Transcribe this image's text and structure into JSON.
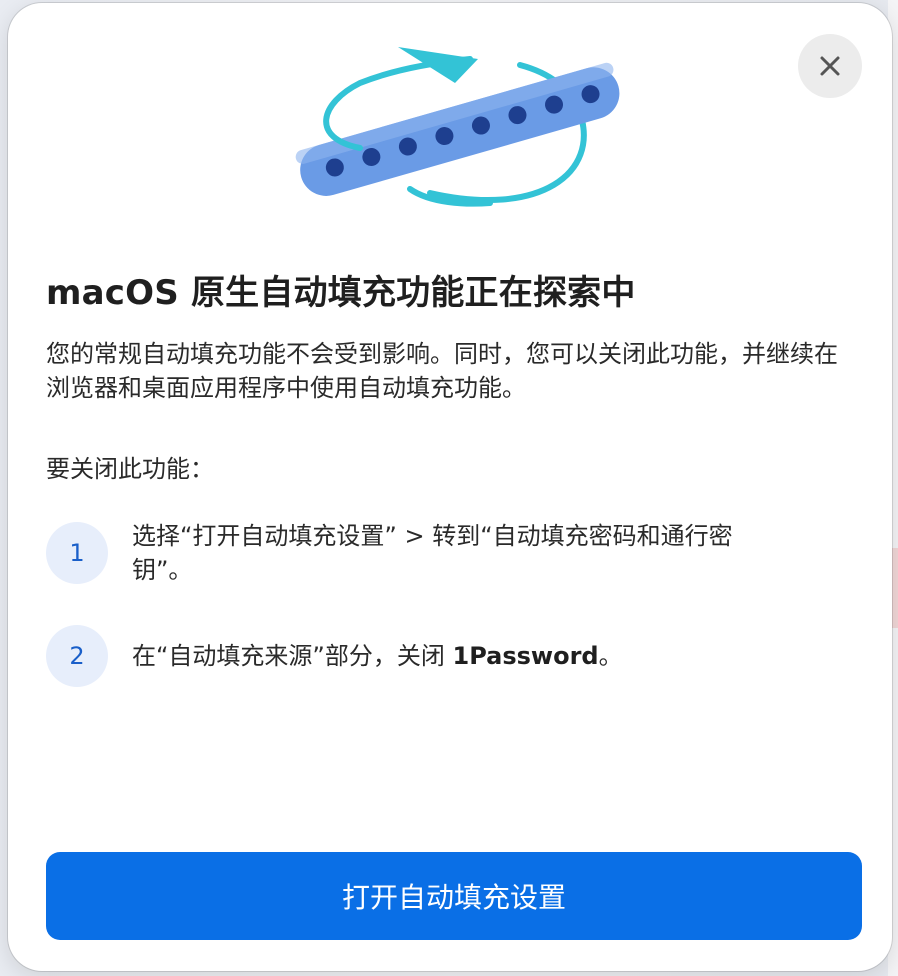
{
  "dialog": {
    "close_icon": "close-icon",
    "illustration_icon": "password-rotate-illustration",
    "title": "macOS 原生自动填充功能正在探索中",
    "description": "您的常规自动填充功能不会受到影响。同时，您可以关闭此功能，并继续在浏览器和桌面应用程序中使用自动填充功能。",
    "howto_label": "要关闭此功能：",
    "steps": [
      {
        "number": "1",
        "text": "选择“打开自动填充设置” > 转到“自动填充密码和通行密钥”。"
      },
      {
        "number": "2",
        "text_before": "在“自动填充来源”部分，关闭 ",
        "text_bold": "1Password",
        "text_after": "。"
      }
    ],
    "primary_button": "打开自动填充设置"
  },
  "colors": {
    "primary": "#0a6fe6",
    "step_badge_bg": "#e7eefb",
    "step_badge_text": "#1a5fc9",
    "illustration_bar": "#6a9be6",
    "illustration_arrow": "#33c3d6"
  }
}
